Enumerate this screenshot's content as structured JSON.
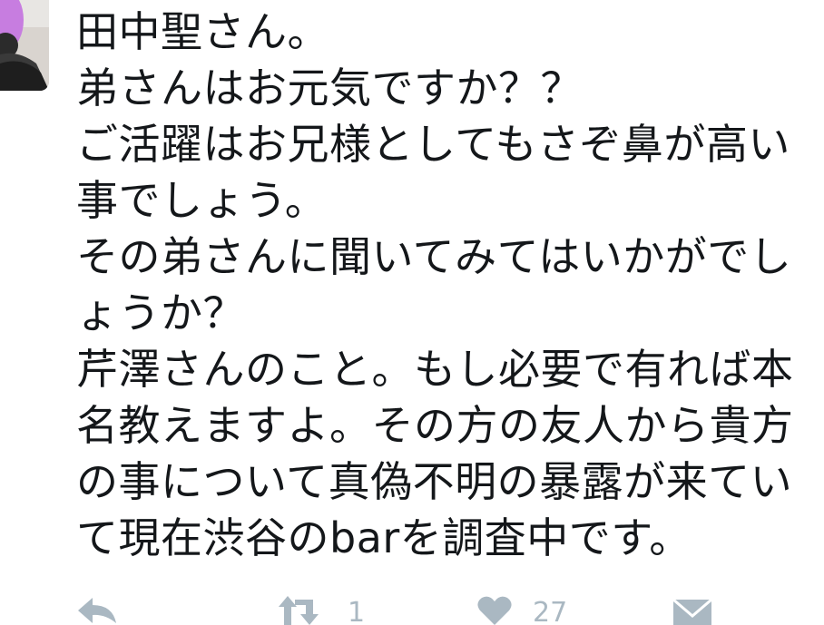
{
  "tweet": {
    "lines": [
      "田中聖さん。",
      "弟さんはお元気ですか？？",
      "ご活躍はお兄様としてもさぞ鼻が高い",
      "事でしょう。",
      "その弟さんに聞いてみてはいかがでし",
      "ょうか？",
      "芹澤さんのこと。もし必要で有れば本",
      "名教えますよ。その方の友人から貴方",
      "の事について真偽不明の暴露が来てい",
      "て現在渋谷のbarを調査中です。"
    ]
  },
  "actions": {
    "reply": {
      "icon": "reply-icon"
    },
    "retweet": {
      "icon": "retweet-icon",
      "count": "1"
    },
    "like": {
      "icon": "heart-icon",
      "count": "27"
    },
    "direct_message": {
      "icon": "envelope-icon"
    }
  },
  "colors": {
    "text": "#14171a",
    "action_gray": "#aab8c2",
    "avatar_hair": "#c77de0"
  }
}
